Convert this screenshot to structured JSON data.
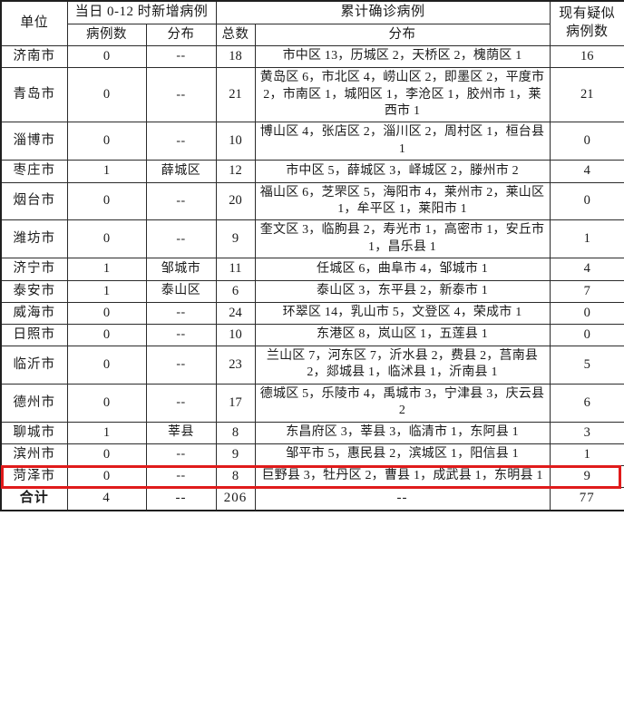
{
  "table": {
    "headers": {
      "unit": "单位",
      "new_group": "当日 0-12 时新增病例",
      "new_count": "病例数",
      "new_dist": "分布",
      "total_group": "累计确诊病例",
      "total_count": "总数",
      "total_dist": "分布",
      "suspected": "现有疑似\n病例数",
      "suspected_line1": "现有疑似",
      "suspected_line2": "病例数"
    },
    "dash": "--",
    "rows": [
      {
        "unit": "济南市",
        "new_count": "0",
        "new_dist": "--",
        "total_count": "18",
        "total_dist": "市中区 13，历城区 2，天桥区 2，槐荫区 1",
        "suspected": "16",
        "dist_align": "center",
        "highlight": false
      },
      {
        "unit": "青岛市",
        "new_count": "0",
        "new_dist": "--",
        "total_count": "21",
        "total_dist": "黄岛区 6，市北区 4，崂山区 2，即墨区 2，平度市 2，市南区 1，城阳区 1，李沧区 1，胶州市 1，莱西市 1",
        "suspected": "21",
        "dist_align": "left",
        "highlight": false
      },
      {
        "unit": "淄博市",
        "new_count": "0",
        "new_dist": "--",
        "total_count": "10",
        "total_dist": "博山区 4，张店区 2，淄川区 2，周村区 1，桓台县 1",
        "suspected": "0",
        "dist_align": "left",
        "highlight": false
      },
      {
        "unit": "枣庄市",
        "new_count": "1",
        "new_dist": "薛城区",
        "total_count": "12",
        "total_dist": "市中区 5，薛城区 3，峄城区 2，滕州市 2",
        "suspected": "4",
        "dist_align": "center",
        "highlight": false
      },
      {
        "unit": "烟台市",
        "new_count": "0",
        "new_dist": "--",
        "total_count": "20",
        "total_dist": "福山区 6，芝罘区 5，海阳市 4，莱州市 2，莱山区 1，牟平区 1，莱阳市 1",
        "suspected": "0",
        "dist_align": "left",
        "highlight": false
      },
      {
        "unit": "潍坊市",
        "new_count": "0",
        "new_dist": "--",
        "total_count": "9",
        "total_dist": "奎文区 3，临朐县 2，寿光市 1，高密市 1，安丘市 1，昌乐县 1",
        "suspected": "1",
        "dist_align": "left",
        "highlight": false
      },
      {
        "unit": "济宁市",
        "new_count": "1",
        "new_dist": "邹城市",
        "total_count": "11",
        "total_dist": "任城区 6，曲阜市 4，邹城市 1",
        "suspected": "4",
        "dist_align": "left",
        "highlight": false
      },
      {
        "unit": "泰安市",
        "new_count": "1",
        "new_dist": "泰山区",
        "total_count": "6",
        "total_dist": "泰山区 3，东平县 2，新泰市 1",
        "suspected": "7",
        "dist_align": "left",
        "highlight": false
      },
      {
        "unit": "威海市",
        "new_count": "0",
        "new_dist": "--",
        "total_count": "24",
        "total_dist": "环翠区 14，乳山市 5，文登区 4，荣成市 1",
        "suspected": "0",
        "dist_align": "left",
        "highlight": false
      },
      {
        "unit": "日照市",
        "new_count": "0",
        "new_dist": "--",
        "total_count": "10",
        "total_dist": "东港区 8，岚山区 1，五莲县 1",
        "suspected": "0",
        "dist_align": "left",
        "highlight": false
      },
      {
        "unit": "临沂市",
        "new_count": "0",
        "new_dist": "--",
        "total_count": "23",
        "total_dist": "兰山区 7，河东区 7，沂水县 2，费县 2，莒南县 2，郯城县 1，临沭县 1，沂南县 1",
        "suspected": "5",
        "dist_align": "left",
        "highlight": false
      },
      {
        "unit": "德州市",
        "new_count": "0",
        "new_dist": "--",
        "total_count": "17",
        "total_dist": "德城区 5，乐陵市 4，禹城市 3，宁津县 3，庆云县 2",
        "suspected": "6",
        "dist_align": "left",
        "highlight": false
      },
      {
        "unit": "聊城市",
        "new_count": "1",
        "new_dist": "莘县",
        "total_count": "8",
        "total_dist": "东昌府区 3，莘县 3，临清市 1，东阿县 1",
        "suspected": "3",
        "dist_align": "left",
        "highlight": false
      },
      {
        "unit": "滨州市",
        "new_count": "0",
        "new_dist": "--",
        "total_count": "9",
        "total_dist": "邹平市 5，惠民县 2，滨城区 1，阳信县 1",
        "suspected": "1",
        "dist_align": "left",
        "highlight": false
      },
      {
        "unit": "菏泽市",
        "new_count": "0",
        "new_dist": "--",
        "total_count": "8",
        "total_dist": "巨野县 3，牡丹区 2，曹县 1，成武县 1，东明县 1",
        "suspected": "9",
        "dist_align": "left",
        "highlight": true
      }
    ],
    "total_row": {
      "unit": "合计",
      "new_count": "4",
      "new_dist": "--",
      "total_count": "206",
      "total_dist": "--",
      "suspected": "77"
    }
  },
  "colors": {
    "highlight_border": "#e01b1b",
    "grid": "#2b2b2b",
    "text": "#1a1a1a",
    "background": "#ffffff"
  }
}
